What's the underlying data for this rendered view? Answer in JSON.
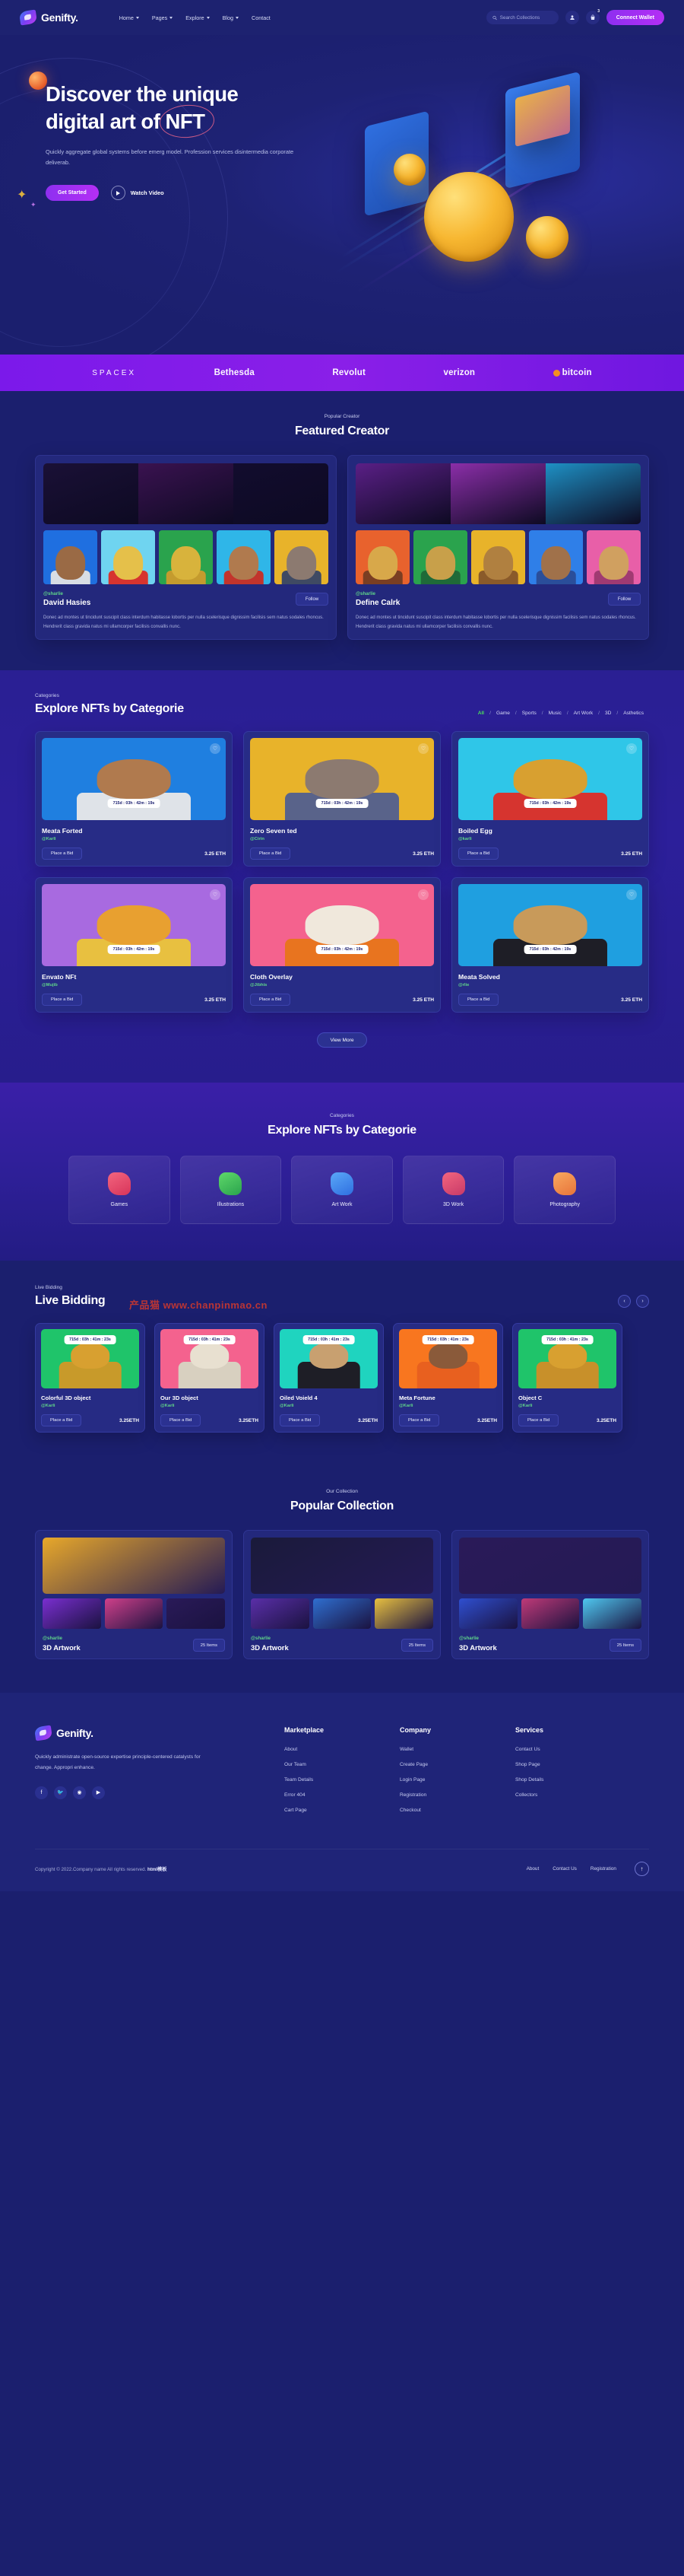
{
  "header": {
    "brand": "Genifty.",
    "nav": [
      {
        "label": "Home",
        "caret": true
      },
      {
        "label": "Pages",
        "caret": true
      },
      {
        "label": "Explore",
        "caret": true
      },
      {
        "label": "Blog",
        "caret": true
      },
      {
        "label": "Contact",
        "caret": false
      }
    ],
    "search_placeholder": "Search Collections",
    "user_icon": "user-icon",
    "cart_icon": "bag-icon",
    "cart_badge": "3",
    "connect_label": "Connect Wallet"
  },
  "hero": {
    "title_line1": "Discover the unique",
    "title_line2_pre": "digital art of ",
    "title_highlight": "NFT",
    "subtitle": "Quickly aggregate global systems before emerg model. Profession services disintermedia corporate deliverab.",
    "primary_cta": "Get Started",
    "secondary_cta": "Watch Video"
  },
  "brands": [
    {
      "name": "SPACEX",
      "style": "spacex"
    },
    {
      "name": "Bethesda",
      "style": "bold"
    },
    {
      "name": "Revolut",
      "style": "bold"
    },
    {
      "name": "verizon",
      "style": "bold"
    },
    {
      "name": "bitcoin",
      "style": "btc"
    }
  ],
  "featured": {
    "eyebrow": "Popular Creator",
    "title": "Featured Creator",
    "follow_label": "Follow",
    "creators": [
      {
        "handle": "@sharlie",
        "name": "David Hasies",
        "desc": "Donec ad montes ut tincidunt suscipit class interdum habitasse lobortis per nulla scelerisque dignissim facilisis sem natus sodales rhoncus. Hendrerit class gravida natus mi ullamcorper facilisis convallis nunc.",
        "banner_colors": [
          "#1a1036",
          "#3a1250",
          "#120c2e"
        ],
        "avatars": [
          {
            "bg": "#1f6fe0",
            "skin": "#9a6a45",
            "body": "#d8dde4"
          },
          {
            "bg": "#6fd4f0",
            "skin": "#e5c04a",
            "body": "#d6342f"
          },
          {
            "bg": "#2aa34d",
            "skin": "#d8b33c",
            "body": "#c49b2e"
          },
          {
            "bg": "#2fb6e8",
            "skin": "#b07a4e",
            "body": "#c2342c"
          },
          {
            "bg": "#e8b32a",
            "skin": "#8c7a70",
            "body": "#3f4a63"
          }
        ]
      },
      {
        "handle": "@sharlie",
        "name": "Define Calrk",
        "desc": "Donec ad montes ut tincidunt suscipit class interdum habitasse lobortis per nulla scelerisque dignissim facilisis sem natus sodales rhoncus. Hendrerit class gravida natus mi ullamcorper facilisis convallis nunc.",
        "banner_colors": [
          "#5a1f86",
          "#8b2ea8",
          "#1e90c4"
        ],
        "avatars": [
          {
            "bg": "#e8622d",
            "skin": "#d8a84a",
            "body": "#7a3e22"
          },
          {
            "bg": "#2aa34d",
            "skin": "#c8a04a",
            "body": "#1f6a38"
          },
          {
            "bg": "#e8b32a",
            "skin": "#b08040",
            "body": "#8a5a2a"
          },
          {
            "bg": "#2f7fe8",
            "skin": "#a0714a",
            "body": "#2a4e9a"
          },
          {
            "bg": "#e85fa8",
            "skin": "#d0a060",
            "body": "#a03a72"
          }
        ]
      }
    ]
  },
  "explore": {
    "eyebrow": "Categories",
    "title": "Explore NFTs by Categorie",
    "filters": [
      "All",
      "Game",
      "Sports",
      "Music",
      "Art Work",
      "3D",
      "Asthetics"
    ],
    "active_filter": "All",
    "bid_label": "Place a Bid",
    "view_more": "View More",
    "items": [
      {
        "title": "Meata Forted",
        "handle": "@Karli",
        "price": "3.25 ETH",
        "timer": "715d : 03h : 42m : 19s",
        "bg": "#1f7fe0",
        "skin": "#b07a4e",
        "body": "#dfe3e8"
      },
      {
        "title": "Zero Seven ted",
        "handle": "@Cirin",
        "price": "3.25 ETH",
        "timer": "715d : 03h : 42m : 19s",
        "bg": "#e8b32a",
        "skin": "#8c7a70",
        "body": "#59638a"
      },
      {
        "title": "Boiled Egg",
        "handle": "@karli",
        "price": "3.25 ETH",
        "timer": "715d : 03h : 42m : 19s",
        "bg": "#2fc6e8",
        "skin": "#d8a030",
        "body": "#d6342f"
      },
      {
        "title": "Envato NFt",
        "handle": "@Mujib",
        "price": "3.25 ETH",
        "timer": "715d : 03h : 42m : 19s",
        "bg": "#a86ae0",
        "skin": "#e8a030",
        "body": "#e8c040"
      },
      {
        "title": "Cloth Overlay",
        "handle": "@Jibhis",
        "price": "3.25 ETH",
        "timer": "715d : 03h : 42m : 19s",
        "bg": "#f4628e",
        "skin": "#f0e8dc",
        "body": "#e8741f"
      },
      {
        "title": "Meata Solved",
        "handle": "@rlie",
        "price": "3.25 ETH",
        "timer": "715d : 03h : 42m : 19s",
        "bg": "#1f9fe0",
        "skin": "#c89a5a",
        "body": "#1e1e26"
      }
    ]
  },
  "categories": {
    "eyebrow": "Categories",
    "title": "Explore NFTs by Categorie",
    "items": [
      {
        "label": "Games",
        "icon": "games-icon",
        "color1": "#f2657f",
        "color2": "#d8345a"
      },
      {
        "label": "Illustrations",
        "icon": "pencil-icon",
        "color1": "#5fd86a",
        "color2": "#2aa34d"
      },
      {
        "label": "Art Work",
        "icon": "image-icon",
        "color1": "#5aa8f8",
        "color2": "#2f6fe0"
      },
      {
        "label": "3D Work",
        "icon": "gear-icon",
        "color1": "#f2657f",
        "color2": "#c83a68"
      },
      {
        "label": "Photography",
        "icon": "camera-icon",
        "color1": "#f8a85f",
        "color2": "#e8743a"
      }
    ]
  },
  "live_bidding": {
    "eyebrow": "Live Bidding",
    "title": "Live Bidding",
    "prev_icon": "chevron-left-icon",
    "next_icon": "chevron-right-icon",
    "bid_label": "Place a Bid",
    "items": [
      {
        "title": "Colorful 3D object",
        "handle": "@Karli",
        "price": "3.25ETH",
        "timer": "715d : 03h : 41m : 23s",
        "bg": "#1fc46a",
        "skin": "#d8a030",
        "body": "#c89a2a"
      },
      {
        "title": "Our 3D object",
        "handle": "@Karli",
        "price": "3.25ETH",
        "timer": "715d : 03h : 41m : 23s",
        "bg": "#f4628e",
        "skin": "#e8e0d0",
        "body": "#d8d0c0"
      },
      {
        "title": "Oiled Voield 4",
        "handle": "@Karli",
        "price": "3.25ETH",
        "timer": "715d : 03h : 41m : 23s",
        "bg": "#1fd4bf",
        "skin": "#c8a070",
        "body": "#1e1e26"
      },
      {
        "title": "Meta Fortune",
        "handle": "@Karli",
        "price": "3.25ETH",
        "timer": "715d : 03h : 41m : 23s",
        "bg": "#f8761f",
        "skin": "#8a5a3a",
        "body": "#e8601f"
      },
      {
        "title": "Object C",
        "handle": "@Karli",
        "price": "3.25ETH",
        "timer": "715d : 03h : 41m : 23s",
        "bg": "#1fc46a",
        "skin": "#d8a030",
        "body": "#c8902a"
      }
    ]
  },
  "collection": {
    "eyebrow": "Our Collection",
    "title": "Popular Collection",
    "items": [
      {
        "handle": "@sharlie",
        "name": "3D Artwork",
        "items_count": "25 Items",
        "main_bg": "#e8a82a",
        "thumbs": [
          "#7a2fd0",
          "#d0408a",
          "#2a1a58"
        ]
      },
      {
        "handle": "@sharlie",
        "name": "3D Artwork",
        "items_count": "25 Items",
        "main_bg": "#1a1a3a",
        "thumbs": [
          "#5a2fa8",
          "#2f6fd0",
          "#e8c040"
        ]
      },
      {
        "handle": "@sharlie",
        "name": "3D Artwork",
        "items_count": "25 Items",
        "main_bg": "#2a1a58",
        "thumbs": [
          "#2f4fd0",
          "#c03a78",
          "#4fc8f0"
        ]
      }
    ]
  },
  "footer": {
    "brand": "Genifty.",
    "desc": "Quickly administrate open-source expertise principle-centered catalysts for change. Appropri enhance.",
    "socials": [
      "facebook-icon",
      "twitter-icon",
      "instagram-icon",
      "youtube-icon"
    ],
    "columns": [
      {
        "heading": "Marketplace",
        "links": [
          "About",
          "Our Team",
          "Team Details",
          "Error 404",
          "Cart Page"
        ]
      },
      {
        "heading": "Company",
        "links": [
          "Wallet",
          "Create Page",
          "Login Page",
          "Registration",
          "Checkout"
        ]
      },
      {
        "heading": "Services",
        "links": [
          "Contact Us",
          "Shop Page",
          "Shop Details",
          "Collectors"
        ]
      }
    ],
    "copyright": "Copyright © 2022.Company name All rights reserved.",
    "copyright_suffix": "html模板",
    "bottom_links": [
      "About",
      "Contact Us",
      "Registration"
    ],
    "to_top_icon": "arrow-up-icon"
  },
  "watermark": "产品猫 www.chanpinmao.cn"
}
